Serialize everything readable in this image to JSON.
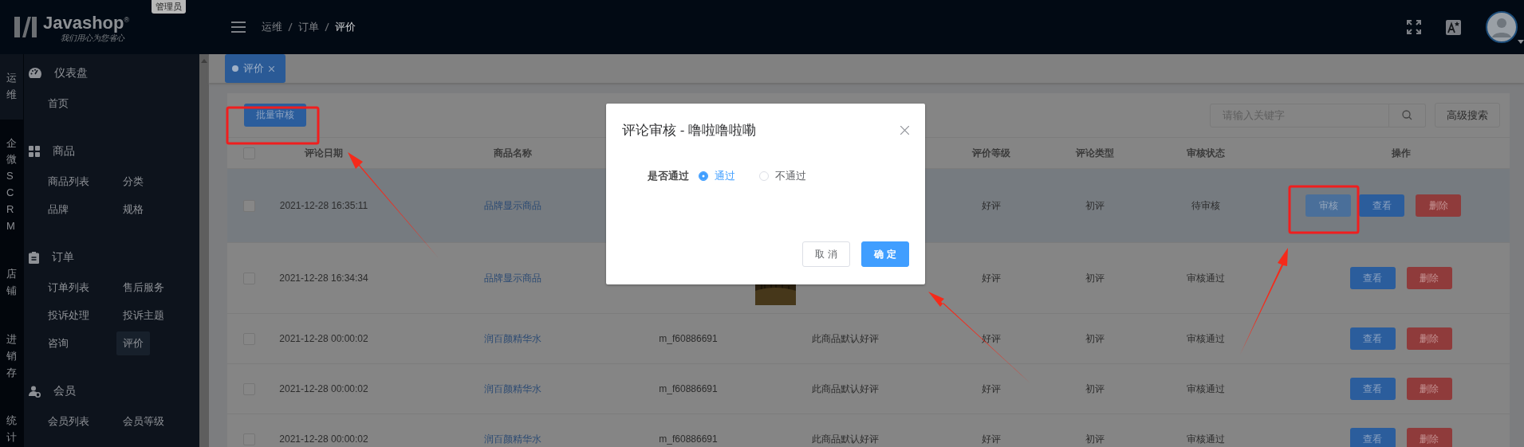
{
  "header": {
    "logo": {
      "name": "Javashop$^{®}$",
      "slogan": "我们用心为您省心"
    },
    "role_badge": "管理员",
    "breadcrumb": [
      {
        "label": "运维"
      },
      {
        "label": "订单"
      },
      {
        "label": "评价"
      }
    ]
  },
  "module_nav": [
    {
      "label": "运维",
      "selected": true
    },
    {
      "label": "企微SCRM",
      "selected": false
    },
    {
      "label": "店铺",
      "selected": false
    },
    {
      "label": "进销存",
      "selected": false
    },
    {
      "label": "统计",
      "selected": false
    }
  ],
  "sidebar": {
    "groups": [
      {
        "title": "仪表盘",
        "items": [
          {
            "label": "首页",
            "selected": false
          }
        ]
      },
      {
        "title": "商品",
        "items": [
          {
            "label": "商品列表",
            "selected": false
          },
          {
            "label": "分类",
            "selected": false
          },
          {
            "label": "品牌",
            "selected": false
          },
          {
            "label": "规格",
            "selected": false
          }
        ]
      },
      {
        "title": "订单",
        "items": [
          {
            "label": "订单列表",
            "selected": false
          },
          {
            "label": "售后服务",
            "selected": false
          },
          {
            "label": "投诉处理",
            "selected": false
          },
          {
            "label": "投诉主题",
            "selected": false
          },
          {
            "label": "咨询",
            "selected": false
          },
          {
            "label": "评价",
            "selected": true
          }
        ]
      },
      {
        "title": "会员",
        "items": [
          {
            "label": "会员列表",
            "selected": false
          },
          {
            "label": "会员等级",
            "selected": false
          }
        ]
      }
    ]
  },
  "tabs": [
    {
      "label": "评价",
      "selected": true
    }
  ],
  "toolbar": {
    "batch_button": "批量审核",
    "search": {
      "placeholder": "请输入关键字"
    },
    "advanced_search": "高级搜索"
  },
  "table": {
    "header_checkbox": {
      "checked": false
    },
    "columns": [
      "评论日期",
      "商品名称",
      "评价等级",
      "评论类型",
      "审核状态",
      "操作"
    ],
    "rows": [
      {
        "checked": false,
        "selected": true,
        "date": "2021-12-28 16:35:11",
        "product": "品牌显示商品",
        "grade": "好评",
        "type": "初评",
        "status": "待审核",
        "actions": [
          {
            "kind": "review",
            "label": "审核"
          },
          {
            "kind": "view",
            "label": "查看"
          },
          {
            "kind": "delete",
            "label": "删除"
          }
        ]
      },
      {
        "checked": false,
        "selected": false,
        "date": "2021-12-28 16:34:34",
        "product": "品牌显示商品",
        "column_4": {
          "kind": "picture"
        },
        "grade": "好评",
        "type": "初评",
        "status": "审核通过",
        "actions": [
          {
            "kind": "view",
            "label": "查看"
          },
          {
            "kind": "delete",
            "label": "删除"
          }
        ]
      },
      {
        "checked": false,
        "selected": false,
        "date": "2021-12-28 00:00:02",
        "product": "润百颜精华水",
        "column_3": "m_f60886691",
        "column_4": {
          "kind": "text",
          "text": "此商品默认好评"
        },
        "grade": "好评",
        "type": "初评",
        "status": "审核通过",
        "actions": [
          {
            "kind": "view",
            "label": "查看"
          },
          {
            "kind": "delete",
            "label": "删除"
          }
        ]
      },
      {
        "checked": false,
        "selected": false,
        "date": "2021-12-28 00:00:02",
        "product": "润百颜精华水",
        "column_3": "m_f60886691",
        "column_4": {
          "kind": "text",
          "text": "此商品默认好评"
        },
        "grade": "好评",
        "type": "初评",
        "status": "审核通过",
        "actions": [
          {
            "kind": "view",
            "label": "查看"
          },
          {
            "kind": "delete",
            "label": "删除"
          }
        ]
      },
      {
        "checked": false,
        "selected": false,
        "date": "2021-12-28 00:00:02",
        "product": "润百颜精华水",
        "column_3": "m_f60886691",
        "column_4": {
          "kind": "text",
          "text": "此商品默认好评"
        },
        "grade": "好评",
        "type": "初评",
        "status": "审核通过",
        "actions": [
          {
            "kind": "view",
            "label": "查看"
          },
          {
            "kind": "delete",
            "label": "删除"
          }
        ]
      }
    ]
  },
  "dialog": {
    "title": "评论审核 - 噜啦噜啦嘞",
    "field_label": "是否通过",
    "options": [
      {
        "label": "通过",
        "selected": true
      },
      {
        "label": "不通过",
        "selected": false
      }
    ],
    "buttons": [
      {
        "kind": "secondary",
        "label": "取 消"
      },
      {
        "kind": "primary",
        "label": "确 定"
      }
    ]
  }
}
